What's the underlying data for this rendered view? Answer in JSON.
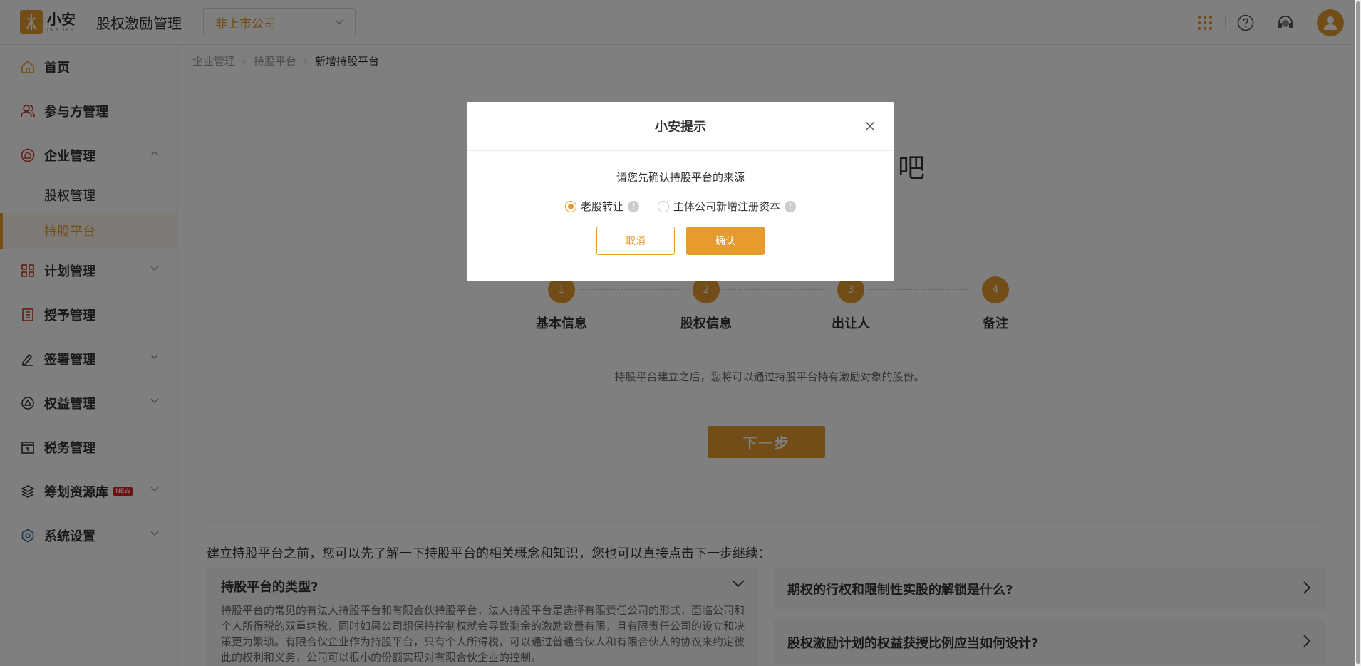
{
  "header": {
    "logo_cn": "小安",
    "logo_en": "INNOPE",
    "app_title": "股权激励管理",
    "company_select": "非上市公司"
  },
  "sidebar": {
    "items": [
      {
        "label": "首页",
        "icon": "home-icon"
      },
      {
        "label": "参与方管理",
        "icon": "users-icon"
      },
      {
        "label": "企业管理",
        "icon": "company-icon"
      },
      {
        "label": "计划管理",
        "icon": "grid-icon"
      },
      {
        "label": "授予管理",
        "icon": "book-icon"
      },
      {
        "label": "签署管理",
        "icon": "sign-icon"
      },
      {
        "label": "权益管理",
        "icon": "rights-icon"
      },
      {
        "label": "税务管理",
        "icon": "tax-icon"
      },
      {
        "label": "筹划资源库",
        "icon": "layers-icon",
        "badge": "NEW"
      },
      {
        "label": "系统设置",
        "icon": "settings-icon"
      }
    ],
    "sub_items": [
      {
        "label": "股权管理"
      },
      {
        "label": "持股平台"
      }
    ]
  },
  "breadcrumb": [
    "企业管理",
    "持股平台",
    "新增持股平台"
  ],
  "hero_title_tail": "吧",
  "steps": [
    {
      "num": "1",
      "label": "基本信息"
    },
    {
      "num": "2",
      "label": "股权信息"
    },
    {
      "num": "3",
      "label": "出让人"
    },
    {
      "num": "4",
      "label": "备注"
    }
  ],
  "hint": "持股平台建立之后，您将可以通过持股平台持有激励对象的股份。",
  "next_button": "下一步",
  "intro": "建立持股平台之前，您可以先了解一下持股平台的相关概念和知识，您也可以直接点击下一步继续：",
  "faq": {
    "left": {
      "question": "持股平台的类型?",
      "answer": "持股平台的常见的有法人持股平台和有限合伙持股平台，法人持股平台是选择有限责任公司的形式，面临公司和个人所得税的双重纳税，同时如果公司想保持控制权就会导致剩余的激励数量有限，且有限责任公司的设立和决策更为繁琐。有限合伙企业作为持股平台，只有个人所得税，可以通过普通合伙人和有限合伙人的协议来约定彼此的权利和义务，公司可以很小的份额实现对有限合伙企业的控制。"
    },
    "right": [
      {
        "question": "期权的行权和限制性实股的解锁是什么?"
      },
      {
        "question": "股权激励计划的权益获授比例应当如何设计?"
      }
    ]
  },
  "modal": {
    "title": "小安提示",
    "message": "请您先确认持股平台的来源",
    "options": [
      {
        "label": "老股转让",
        "selected": true
      },
      {
        "label": "主体公司新增注册资本",
        "selected": false
      }
    ],
    "cancel": "取消",
    "confirm": "确认"
  },
  "colors": {
    "accent": "#e69b2e",
    "badge": "#e02020"
  }
}
